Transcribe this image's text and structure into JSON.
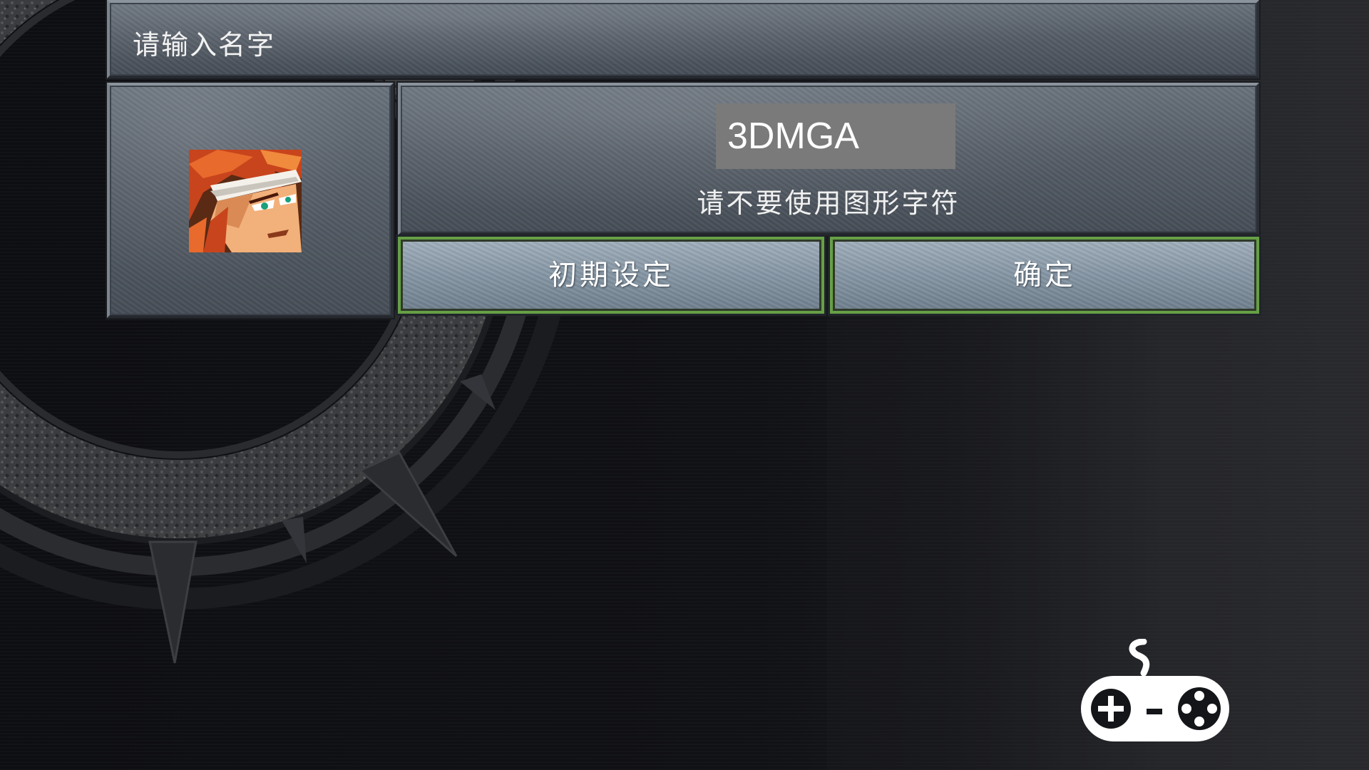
{
  "dialog": {
    "title": "请输入名字",
    "name_value": "3DMGA",
    "hint": "请不要使用图形字符"
  },
  "buttons": {
    "reset_label": "初期设定",
    "confirm_label": "确定"
  },
  "portrait": {
    "character": "red-haired hero"
  },
  "icons": {
    "gamepad": "gamepad-icon"
  },
  "colors": {
    "button_border": "#66a046",
    "panel": "#565e68",
    "input_bg": "#7a7a7a",
    "background": "#0f1013"
  }
}
